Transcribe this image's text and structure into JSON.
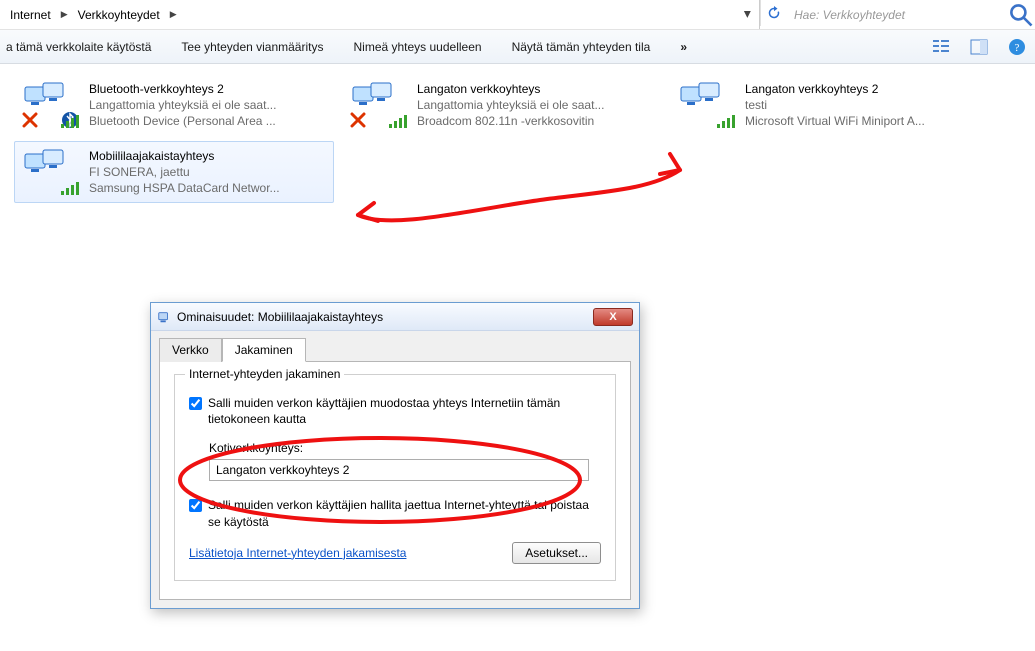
{
  "breadcrumb": {
    "item1": "Internet",
    "item2": "Verkkoyhteydet"
  },
  "search": {
    "placeholder": "Hae: Verkkoyhteydet"
  },
  "toolbar": {
    "cmd_disable": "a tämä verkkolaite käytöstä",
    "cmd_diagnose": "Tee yhteyden vianmääritys",
    "cmd_rename": "Nimeä yhteys uudelleen",
    "cmd_status": "Näytä tämän yhteyden tila",
    "overflow": "»"
  },
  "connections": [
    {
      "title": "Bluetooth-verkkoyhteys 2",
      "line2": "Langattomia yhteyksiä ei ole saat...",
      "line3": "Bluetooth Device (Personal Area ...",
      "disabled": true,
      "bt": true,
      "signal": true
    },
    {
      "title": "Langaton verkkoyhteys",
      "line2": "Langattomia yhteyksiä ei ole saat...",
      "line3": "Broadcom 802.11n -verkkosovitin",
      "disabled": true,
      "bt": false,
      "signal": true
    },
    {
      "title": "Langaton verkkoyhteys 2",
      "line2": "testi",
      "line3": "Microsoft Virtual WiFi Miniport A...",
      "disabled": false,
      "bt": false,
      "signal": true
    },
    {
      "title": "Mobiililaajakaistayhteys",
      "line2": "FI SONERA, jaettu",
      "line3": "Samsung HSPA DataCard Networ...",
      "disabled": false,
      "bt": false,
      "signal": true,
      "selected": true
    }
  ],
  "dialog": {
    "title": "Ominaisuudet: Mobiililaajakaistayhteys",
    "close": "X",
    "tab_network": "Verkko",
    "tab_sharing": "Jakaminen",
    "group_legend": "Internet-yhteyden jakaminen",
    "chk1": "Salli muiden verkon käyttäjien muodostaa yhteys Internetiin tämän tietokoneen kautta",
    "home_label": "Kotiverkkoyhteys:",
    "home_value": "Langaton verkkoyhteys 2",
    "chk2": "Salli muiden verkon käyttäjien hallita jaettua Internet-yhteyttä tai poistaa se käytöstä",
    "more_link": "Lisätietoja Internet-yhteyden jakamisesta",
    "settings_btn": "Asetukset..."
  }
}
